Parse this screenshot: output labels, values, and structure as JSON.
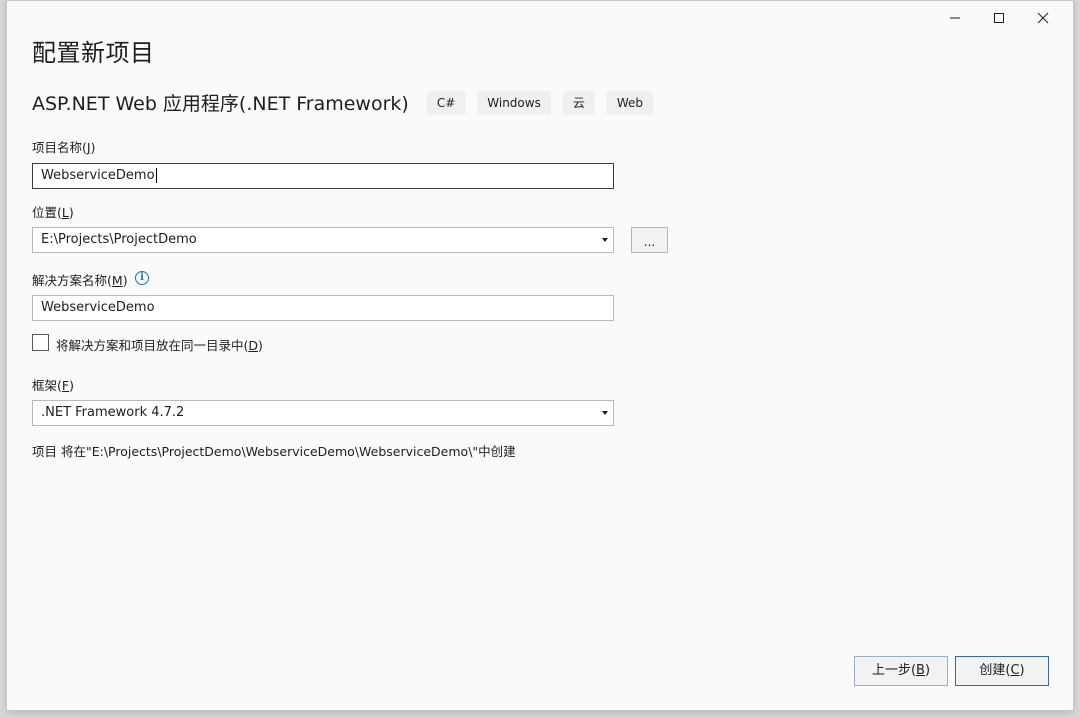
{
  "window": {
    "title": "配置新项目",
    "controls": {
      "minimize": "minimize-icon",
      "maximize": "maximize-icon",
      "close": "close-icon"
    }
  },
  "template": {
    "name": "ASP.NET Web 应用程序(.NET Framework)",
    "tags": [
      "C#",
      "Windows",
      "云",
      "Web"
    ]
  },
  "form": {
    "project_name": {
      "label": "项目名称",
      "access_key": "J",
      "value": "WebserviceDemo"
    },
    "location": {
      "label": "位置",
      "access_key": "L",
      "value": "E:\\Projects\\ProjectDemo",
      "browse_label": "..."
    },
    "solution_name": {
      "label": "解决方案名称",
      "access_key": "M",
      "value": "WebserviceDemo",
      "info_icon": "info-icon"
    },
    "same_dir": {
      "label": "将解决方案和项目放在同一目录中",
      "access_key": "D",
      "checked": false
    },
    "framework": {
      "label": "框架",
      "access_key": "F",
      "value": ".NET Framework 4.7.2"
    },
    "summary": "项目 将在\"E:\\Projects\\ProjectDemo\\WebserviceDemo\\WebserviceDemo\\\"中创建"
  },
  "buttons": {
    "back": {
      "label": "上一步",
      "access_key": "B"
    },
    "create": {
      "label": "创建",
      "access_key": "C"
    }
  },
  "colors": {
    "dialog_bg": "#fafafa",
    "accent_border": "#2d6cb5",
    "info_blue": "#1e72c6"
  }
}
